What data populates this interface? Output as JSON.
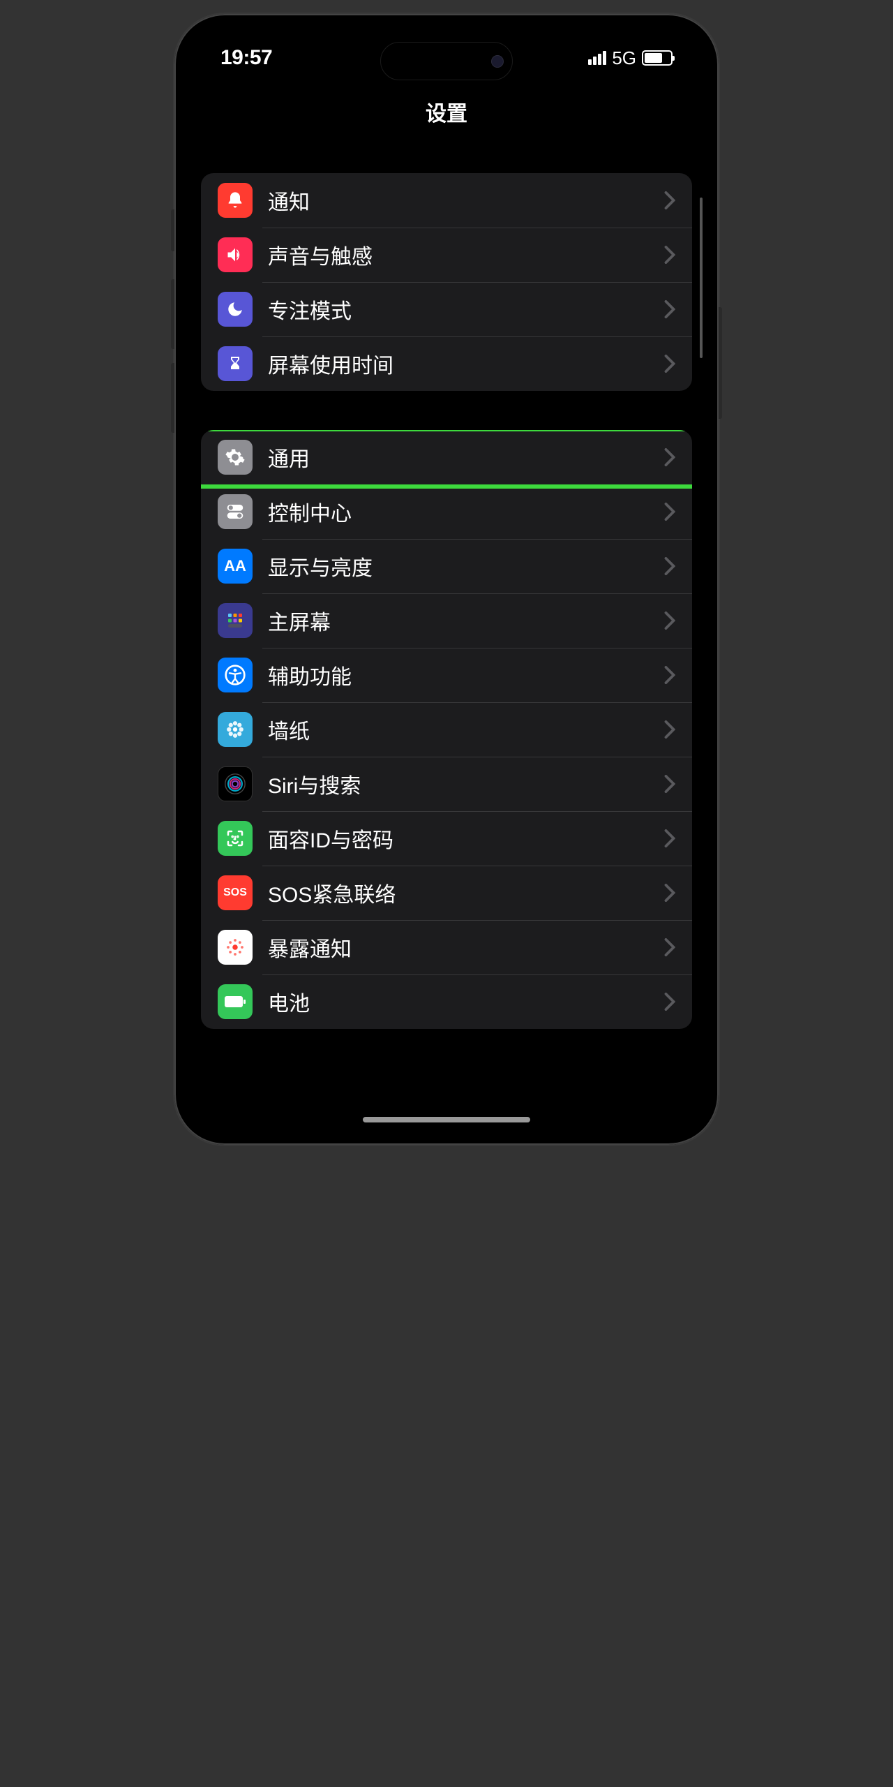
{
  "status": {
    "time": "19:57",
    "network": "5G"
  },
  "header": {
    "title": "设置"
  },
  "groups": [
    {
      "items": [
        {
          "id": "notifications",
          "label": "通知",
          "icon": "bell-icon",
          "color": "bg-red"
        },
        {
          "id": "sounds",
          "label": "声音与触感",
          "icon": "speaker-icon",
          "color": "bg-pink"
        },
        {
          "id": "focus",
          "label": "专注模式",
          "icon": "moon-icon",
          "color": "bg-purple"
        },
        {
          "id": "screentime",
          "label": "屏幕使用时间",
          "icon": "hourglass-icon",
          "color": "bg-purple"
        }
      ]
    },
    {
      "items": [
        {
          "id": "general",
          "label": "通用",
          "icon": "gear-icon",
          "color": "bg-gray",
          "highlighted": true
        },
        {
          "id": "controlcenter",
          "label": "控制中心",
          "icon": "switch-icon",
          "color": "bg-gray"
        },
        {
          "id": "display",
          "label": "显示与亮度",
          "icon": "text-size-icon",
          "color": "bg-blue"
        },
        {
          "id": "homescreen",
          "label": "主屏幕",
          "icon": "grid-icon",
          "color": "bg-blue"
        },
        {
          "id": "accessibility",
          "label": "辅助功能",
          "icon": "accessibility-icon",
          "color": "bg-blue"
        },
        {
          "id": "wallpaper",
          "label": "墙纸",
          "icon": "flower-icon",
          "color": "bg-sky"
        },
        {
          "id": "siri",
          "label": "Siri与搜索",
          "icon": "siri-icon",
          "color": "bg-black"
        },
        {
          "id": "faceid",
          "label": "面容ID与密码",
          "icon": "faceid-icon",
          "color": "bg-green"
        },
        {
          "id": "sos",
          "label": "SOS紧急联络",
          "icon": "sos-icon",
          "color": "bg-redsOS"
        },
        {
          "id": "exposure",
          "label": "暴露通知",
          "icon": "exposure-icon",
          "color": "bg-white"
        },
        {
          "id": "battery",
          "label": "电池",
          "icon": "battery-icon",
          "color": "bg-green"
        }
      ]
    }
  ]
}
